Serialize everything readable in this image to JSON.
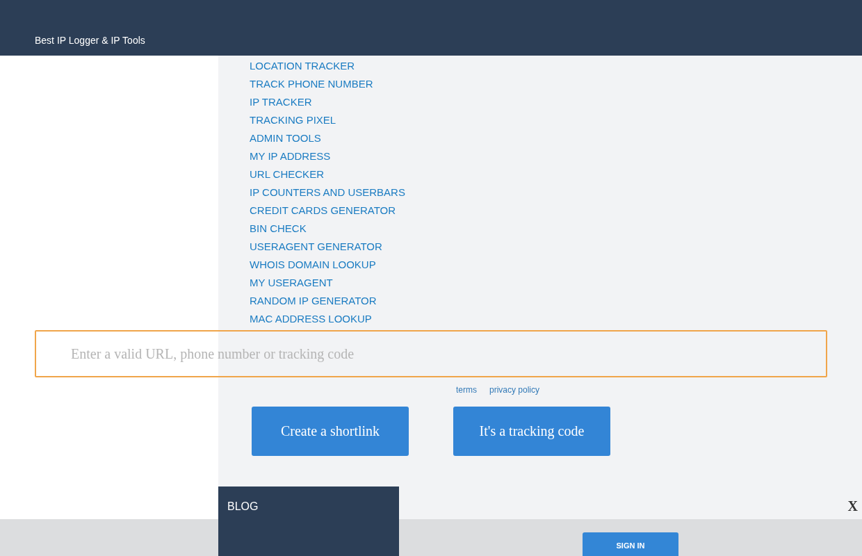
{
  "header": {
    "brand": "Best IP Logger & IP Tools"
  },
  "menu": {
    "items": [
      {
        "label": "LOCATION TRACKER",
        "kind": "plain"
      },
      {
        "label": "TRACK PHONE NUMBER",
        "kind": "plain"
      },
      {
        "label": "IP TRACKER",
        "kind": "plain"
      },
      {
        "label": "TRACKING PIXEL",
        "kind": "plain"
      },
      {
        "label": "ADMIN TOOLS",
        "kind": "plain"
      },
      {
        "label": "MY IP ADDRESS",
        "kind": "plain"
      },
      {
        "label": "URL CHECKER",
        "kind": "plain"
      },
      {
        "label": "IP COUNTERS AND USERBARS",
        "kind": "plain"
      },
      {
        "label": "CREDIT CARDS GENERATOR",
        "kind": "plain"
      },
      {
        "label": "BIN CHECK",
        "kind": "plain"
      },
      {
        "label": "USERAGENT GENERATOR",
        "kind": "plain"
      },
      {
        "label": "WHOIS DOMAIN LOOKUP",
        "kind": "plain"
      },
      {
        "label": "MY USERAGENT",
        "kind": "plain"
      },
      {
        "label": "RANDOM IP GENERATOR",
        "kind": "plain"
      },
      {
        "label": "MAC ADDRESS LOOKUP",
        "kind": "plain"
      },
      {
        "label": "BLOG",
        "kind": "dark"
      }
    ]
  },
  "shortener": {
    "input": {
      "placeholder": "Enter a valid URL, phone number or tracking code"
    },
    "links": [
      "terms",
      "privacy policy"
    ],
    "buttons": [
      "Create a shortlink",
      "It's a tracking code"
    ]
  },
  "banner": {
    "close": "X",
    "button": "SIGN IN"
  }
}
